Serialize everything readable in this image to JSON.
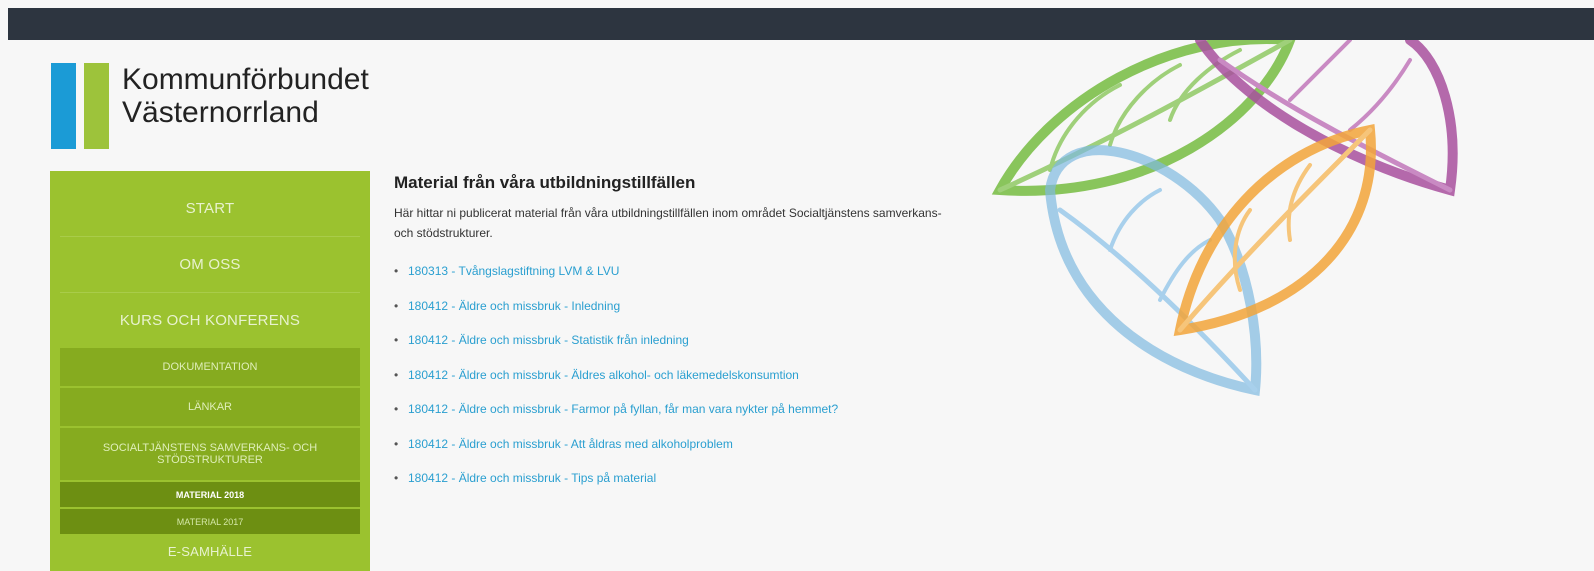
{
  "header": {
    "logo_line1": "Kommunförbundet",
    "logo_line2": "Västernorrland"
  },
  "nav": {
    "items": [
      "START",
      "OM OSS",
      "KURS OCH KONFERENS"
    ],
    "sub_items": [
      "DOKUMENTATION",
      "LÄNKAR",
      "SOCIALTJÄNSTENS SAMVERKANS- OCH STÖDSTRUKTURER"
    ],
    "subsub_items": [
      "MATERIAL 2018",
      "MATERIAL 2017"
    ],
    "next_item": "E-SAMHÄLLE"
  },
  "main": {
    "title": "Material från våra utbildningstillfällen",
    "intro": "Här hittar ni publicerat material från våra utbildningstillfällen inom området Socialtjänstens samverkans- och stödstrukturer.",
    "links": [
      "180313 - Tvångslagstiftning LVM & LVU",
      "180412 - Äldre och missbruk - Inledning",
      "180412 - Äldre och missbruk - Statistik från inledning",
      "180412 - Äldre och missbruk - Äldres alkohol- och läkemedelskonsumtion",
      "180412 - Äldre och missbruk - Farmor på fyllan, får man vara nykter på hemmet?",
      "180412 - Äldre och missbruk - Att åldras med alkoholproblem",
      "180412 - Äldre och missbruk - Tips på material"
    ]
  },
  "colors": {
    "topbar": "#2d3540",
    "nav": "#9bc22f",
    "link": "#2a9fd0",
    "logo_blue": "#1b9bd6",
    "logo_green": "#9dc33b"
  }
}
